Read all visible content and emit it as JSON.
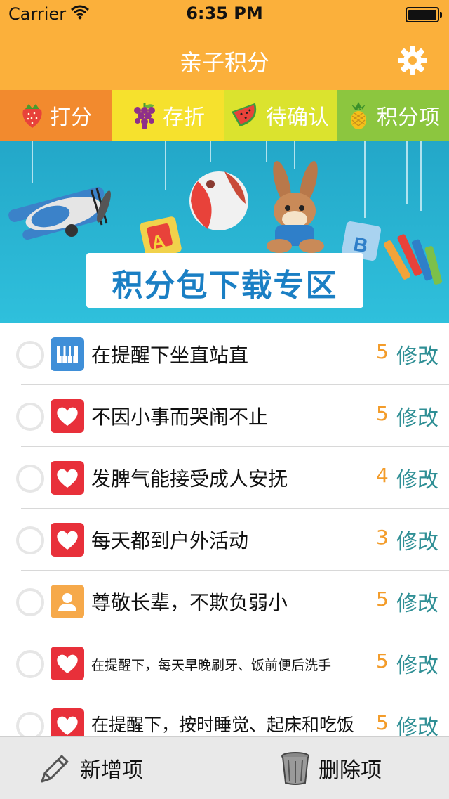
{
  "status": {
    "carrier": "Carrier",
    "time": "6:35 PM"
  },
  "header": {
    "title": "亲子积分",
    "settings_icon": "gear-icon"
  },
  "tabs": [
    {
      "label": "打分",
      "icon": "strawberry-icon",
      "bg": "#f28a2e"
    },
    {
      "label": "存折",
      "icon": "grapes-icon",
      "bg": "#f6e12d"
    },
    {
      "label": "待确认",
      "icon": "watermelon-icon",
      "bg": "#dbe32e"
    },
    {
      "label": "积分项",
      "icon": "pineapple-icon",
      "bg": "#8cc63f"
    }
  ],
  "banner": {
    "text": "积分包下载专区"
  },
  "items": [
    {
      "label": "在提醒下坐直站直",
      "score": "5",
      "edit": "修改",
      "icon": "piano-icon"
    },
    {
      "label": "不因小事而哭闹不止",
      "score": "5",
      "edit": "修改",
      "icon": "heart-icon"
    },
    {
      "label": "发脾气能接受成人安抚",
      "score": "4",
      "edit": "修改",
      "icon": "heart-icon"
    },
    {
      "label": "每天都到户外活动",
      "score": "3",
      "edit": "修改",
      "icon": "heart-icon"
    },
    {
      "label": "尊敬长辈，不欺负弱小",
      "score": "5",
      "edit": "修改",
      "icon": "person-icon"
    },
    {
      "label": "在提醒下，每天早晚刷牙、饭前便后洗手",
      "score": "5",
      "edit": "修改",
      "icon": "heart-icon"
    },
    {
      "label": "在提醒下，按时睡觉、起床和吃饭",
      "score": "5",
      "edit": "修改",
      "icon": "heart-icon"
    }
  ],
  "toolbar": {
    "add_label": "新增项",
    "delete_label": "删除项"
  }
}
